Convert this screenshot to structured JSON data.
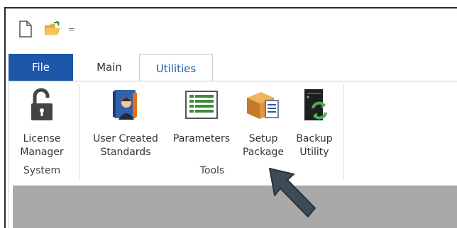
{
  "quick_access": {
    "new_icon": "new-document-icon",
    "open_icon": "open-folder-icon",
    "customize_glyph": "="
  },
  "tabs": [
    {
      "label": "File"
    },
    {
      "label": "Main"
    },
    {
      "label": "Utilities"
    }
  ],
  "ribbon": {
    "system_group": {
      "label": "System",
      "tools": [
        {
          "label": "License\nManager",
          "icon": "unlocked-padlock-icon"
        }
      ]
    },
    "tools_group": {
      "label": "Tools",
      "tools": [
        {
          "label": "User Created\nStandards",
          "icon": "user-book-icon"
        },
        {
          "label": "Parameters",
          "icon": "parameters-list-icon"
        },
        {
          "label": "Setup\nPackage",
          "icon": "setup-package-icon"
        },
        {
          "label": "Backup\nUtility",
          "icon": "backup-server-icon"
        }
      ]
    }
  },
  "colors": {
    "file_tab": "#1e56a8",
    "active_tab_text": "#1f5ea8",
    "workspace": "#a9a9a9",
    "cursor": "#3d4b56"
  },
  "cursor": {
    "icon": "arrow-cursor-icon"
  }
}
